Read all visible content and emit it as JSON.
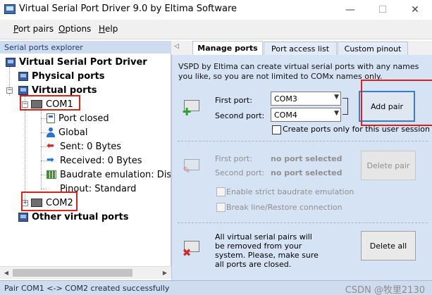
{
  "window": {
    "title": "Virtual Serial Port Driver 9.0 by Eltima Software",
    "controls": {
      "minimize": "—",
      "maximize": "☐",
      "close": "✕"
    }
  },
  "menu": {
    "port_pairs": {
      "accel": "P",
      "rest": "ort pairs"
    },
    "options": {
      "accel": "O",
      "rest": "ptions"
    },
    "help": {
      "accel": "H",
      "rest": "elp"
    }
  },
  "explorer": {
    "header": "Serial ports explorer",
    "tree": {
      "root": "Virtual Serial Port Driver",
      "physical": "Physical ports",
      "virtual": "Virtual ports",
      "com1": "COM1",
      "com1_children": {
        "state": "Port closed",
        "scope": "Global",
        "sent": "Sent: 0 Bytes",
        "received": "Received: 0 Bytes",
        "baudrate": "Baudrate emulation: Disabled",
        "pinout": "Pinout: Standard"
      },
      "com2": "COM2",
      "other": "Other virtual ports"
    },
    "scroll_left": "◀",
    "scroll_right": "▶"
  },
  "tabs": {
    "scroll_icon": "◁",
    "manage": "Manage ports",
    "access": "Port access list",
    "pinout": "Custom pinout"
  },
  "manage": {
    "description": "VSPD by Eltima can create virtual serial ports with any names you like, so you are not limited to COMx names only.",
    "add_section": {
      "icon": "add-pair-icon",
      "first_port_label": "First port:",
      "first_port_value": "COM3",
      "second_port_label": "Second port:",
      "second_port_value": "COM4",
      "add_button": "Add pair",
      "user_session_label": "Create ports only for this user session"
    },
    "delete_section": {
      "icon": "edit-pair-icon",
      "first_port_label": "First port:",
      "first_port_value": "no port selected",
      "second_port_label": "Second port:",
      "second_port_value": "no port selected",
      "delete_button": "Delete pair",
      "strict_baudrate_label": "Enable strict baudrate emulation",
      "break_line_label": "Break line/Restore connection"
    },
    "delete_all_section": {
      "icon": "delete-all-icon",
      "text": "All virtual serial pairs will be removed from your system. Please, make sure all ports are closed.",
      "button": "Delete all"
    }
  },
  "status": {
    "message": "Pair COM1 <-> COM2 created successfully",
    "watermark": "CSDN @牧里2130"
  },
  "colors": {
    "highlight": "#e0201a",
    "panel": "#d6e3f4",
    "header": "#cfdcef",
    "focus": "#3a7bd5"
  }
}
